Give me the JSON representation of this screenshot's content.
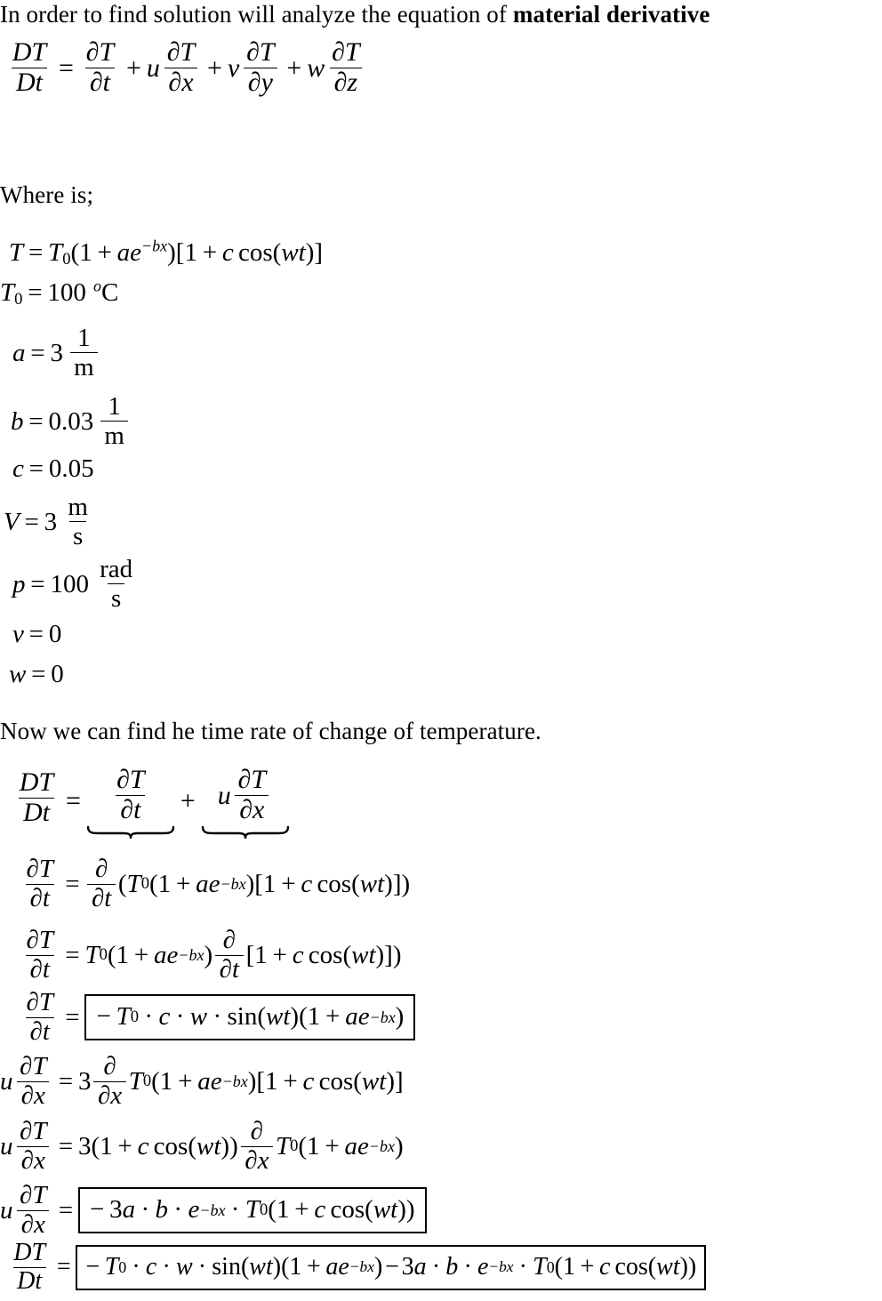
{
  "document": {
    "kind": "math-worksheet",
    "intro": {
      "text_before_bold": "In order to find solution will analyze the equation of ",
      "bold_term": "material derivative"
    },
    "where_label": "Where is;",
    "transition_text": "Now we can find he time rate of change of temperature."
  },
  "material_derivative": {
    "lhs_num": "DT",
    "lhs_den": "Dt",
    "equals": "=",
    "terms": [
      {
        "coefficient": "",
        "num": "∂T",
        "den": "∂t"
      },
      {
        "coefficient": "u",
        "num": "∂T",
        "den": "∂x"
      },
      {
        "coefficient": "v",
        "num": "∂T",
        "den": "∂y"
      },
      {
        "coefficient": "w",
        "num": "∂T",
        "den": "∂z"
      }
    ],
    "plus": "+"
  },
  "givens": [
    {
      "symbol": "T",
      "equals": "=",
      "value": "T₀(1 + ae⁻ᵇˣ)[1 + c cos(wt)]",
      "unit": ""
    },
    {
      "symbol": "T₀",
      "equals": "=",
      "value": "100",
      "unit": "°C"
    },
    {
      "symbol": "a",
      "equals": "=",
      "value": "3",
      "unit_num": "1",
      "unit_den": "m"
    },
    {
      "symbol": "b",
      "equals": "=",
      "value": "0.03",
      "unit_num": "1",
      "unit_den": "m"
    },
    {
      "symbol": "c",
      "equals": "=",
      "value": "0.05",
      "unit": ""
    },
    {
      "symbol": "V",
      "equals": "=",
      "value": "3",
      "unit_num": "m",
      "unit_den": "s"
    },
    {
      "symbol": "p",
      "equals": "=",
      "value": "100",
      "unit_num": "rad",
      "unit_den": "s"
    },
    {
      "symbol": "v",
      "equals": "=",
      "value": "0",
      "unit": ""
    },
    {
      "symbol": "w",
      "equals": "=",
      "value": "0",
      "unit": ""
    }
  ],
  "derivation": {
    "line1": {
      "lhs_num": "DT",
      "lhs_den": "Dt",
      "equals": "=",
      "brace_term_1": {
        "num": "∂T",
        "den": "∂t"
      },
      "plus": "+",
      "brace_term_2": {
        "coefficient": "u",
        "num": "∂T",
        "den": "∂x"
      }
    },
    "line2": {
      "lhs_num": "∂T",
      "lhs_den": "∂t",
      "equals": "=",
      "rhs": "∂/∂t (T₀(1 + ae⁻ᵇˣ)[1 + c cos(wt)])"
    },
    "line3": {
      "lhs_num": "∂T",
      "lhs_den": "∂t",
      "equals": "=",
      "rhs": "T₀(1 + ae⁻ᵇˣ) ∂/∂t [1 + c cos(wt)])"
    },
    "line4": {
      "lhs_num": "∂T",
      "lhs_den": "∂t",
      "equals": "=",
      "boxed": "−T₀ · c · w · sin(wt)(1 + ae⁻ᵇˣ)"
    },
    "line5": {
      "lhs_coeff": "u",
      "lhs_num": "∂T",
      "lhs_den": "∂x",
      "equals": "=",
      "rhs": "3 ∂/∂x T₀(1 + ae⁻ᵇˣ)[1 + c cos(wt)]"
    },
    "line6": {
      "lhs_coeff": "u",
      "lhs_num": "∂T",
      "lhs_den": "∂x",
      "equals": "=",
      "rhs": "3(1 + c cos(wt)) ∂/∂x T₀(1 + ae⁻ᵇˣ)"
    },
    "line7": {
      "lhs_coeff": "u",
      "lhs_num": "∂T",
      "lhs_den": "∂x",
      "equals": "=",
      "boxed": "−3a · b · e⁻ᵇˣ · T₀(1 + c cos(wt))"
    },
    "line8": {
      "lhs_num": "DT",
      "lhs_den": "Dt",
      "equals": "=",
      "boxed": "−T₀ · c · w · sin(wt)(1 + ae⁻ᵇˣ)−3a · b · e⁻ᵇˣ · T₀(1 + c cos(wt))"
    }
  },
  "symbols": {
    "partial": "∂",
    "minus": "−",
    "plus": "+",
    "equals": "=",
    "cdot": "·",
    "degree": "o",
    "sin": "sin",
    "cos": "cos",
    "e": "e",
    "lbrack": "[",
    "rbrack": "]",
    "lparen": "(",
    "rparen": ")"
  }
}
